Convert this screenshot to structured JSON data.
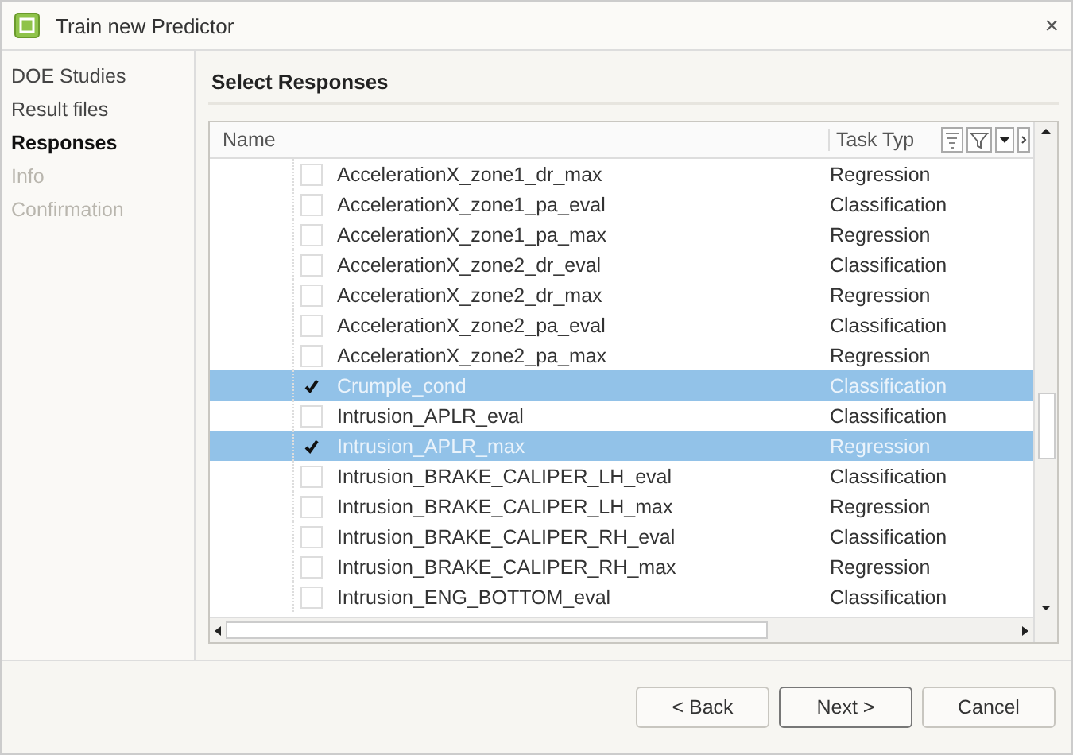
{
  "window": {
    "title": "Train new Predictor",
    "close": "×"
  },
  "sidebar": {
    "items": [
      {
        "label": "DOE Studies",
        "selected": false,
        "disabled": false
      },
      {
        "label": "Result files",
        "selected": false,
        "disabled": false
      },
      {
        "label": "Responses",
        "selected": true,
        "disabled": false
      },
      {
        "label": "Info",
        "selected": false,
        "disabled": true
      },
      {
        "label": "Confirmation",
        "selected": false,
        "disabled": true
      }
    ]
  },
  "section_title": "Select Responses",
  "table": {
    "columns": [
      "Name",
      "Task Typ"
    ],
    "rows": [
      {
        "name": "AccelerationX_zone1_dr_max",
        "task": "Regression",
        "checked": false,
        "selected": false
      },
      {
        "name": "AccelerationX_zone1_pa_eval",
        "task": "Classification",
        "checked": false,
        "selected": false
      },
      {
        "name": "AccelerationX_zone1_pa_max",
        "task": "Regression",
        "checked": false,
        "selected": false
      },
      {
        "name": "AccelerationX_zone2_dr_eval",
        "task": "Classification",
        "checked": false,
        "selected": false
      },
      {
        "name": "AccelerationX_zone2_dr_max",
        "task": "Regression",
        "checked": false,
        "selected": false
      },
      {
        "name": "AccelerationX_zone2_pa_eval",
        "task": "Classification",
        "checked": false,
        "selected": false
      },
      {
        "name": "AccelerationX_zone2_pa_max",
        "task": "Regression",
        "checked": false,
        "selected": false
      },
      {
        "name": "Crumple_cond",
        "task": "Classification",
        "checked": true,
        "selected": true
      },
      {
        "name": "Intrusion_APLR_eval",
        "task": "Classification",
        "checked": false,
        "selected": false
      },
      {
        "name": "Intrusion_APLR_max",
        "task": "Regression",
        "checked": true,
        "selected": true
      },
      {
        "name": "Intrusion_BRAKE_CALIPER_LH_eval",
        "task": "Classification",
        "checked": false,
        "selected": false
      },
      {
        "name": "Intrusion_BRAKE_CALIPER_LH_max",
        "task": "Regression",
        "checked": false,
        "selected": false
      },
      {
        "name": "Intrusion_BRAKE_CALIPER_RH_eval",
        "task": "Classification",
        "checked": false,
        "selected": false
      },
      {
        "name": "Intrusion_BRAKE_CALIPER_RH_max",
        "task": "Regression",
        "checked": false,
        "selected": false
      },
      {
        "name": "Intrusion_ENG_BOTTOM_eval",
        "task": "Classification",
        "checked": false,
        "selected": false
      }
    ]
  },
  "buttons": [
    {
      "label": "< Back",
      "kind": "normal"
    },
    {
      "label": "Next >",
      "kind": "default"
    },
    {
      "label": "Cancel",
      "kind": "normal"
    }
  ]
}
